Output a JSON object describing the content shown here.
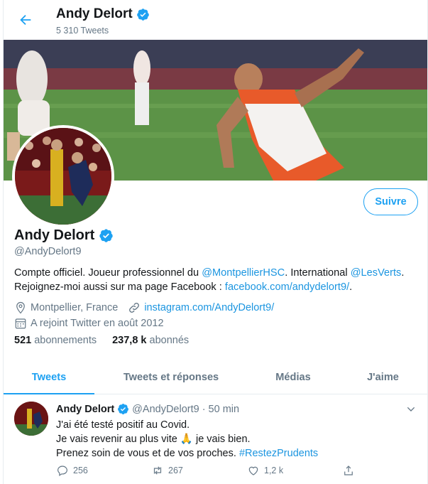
{
  "header": {
    "name": "Andy Delort",
    "tweet_count": "5 310 Tweets"
  },
  "profile": {
    "follow_label": "Suivre",
    "name": "Andy Delort",
    "handle": "@AndyDelort9",
    "bio": {
      "part1": "Compte officiel. Joueur professionnel du ",
      "link1": "@MontpellierHSC",
      "part2": ". International ",
      "link2": "@LesVerts",
      "part3": ".",
      "line2": "Rejoignez-moi aussi sur ma page Facebook : ",
      "link3": "facebook.com/andydelort9/",
      "part4": "."
    },
    "location": "Montpellier, France",
    "website": "instagram.com/AndyDelort9/",
    "joined": "A rejoint Twitter en août 2012",
    "following_count": "521",
    "following_label": "abonnements",
    "followers_count": "237,8 k",
    "followers_label": "abonnés"
  },
  "tabs": [
    {
      "label": "Tweets",
      "active": true
    },
    {
      "label": "Tweets et réponses",
      "active": false
    },
    {
      "label": "Médias",
      "active": false
    },
    {
      "label": "J'aime",
      "active": false
    }
  ],
  "tweet": {
    "name": "Andy Delort",
    "handle": "@AndyDelort9",
    "separator": "·",
    "time": "50 min",
    "line1": "J'ai été testé positif au Covid.",
    "line2a": "Je vais revenir au plus vite ",
    "emoji": "🙏",
    "line2b": " je vais bien.",
    "line3": "Prenez soin de vous et de vos proches. ",
    "hashtag": "#RestezPrudents",
    "replies": "256",
    "retweets": "267",
    "likes": "1,2 k"
  },
  "colors": {
    "accent": "#1da1f2",
    "link": "#1b95e0",
    "secondary_text": "#657786"
  }
}
